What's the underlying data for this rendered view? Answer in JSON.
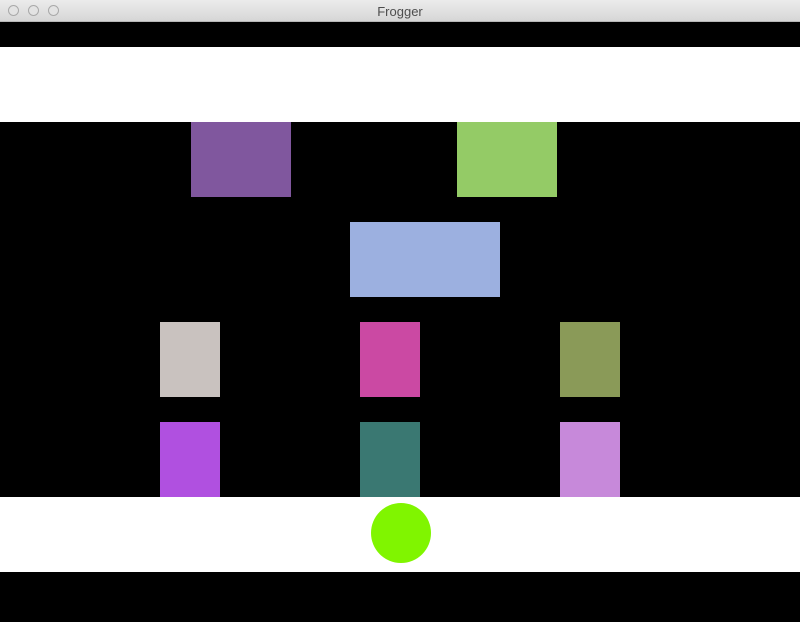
{
  "window": {
    "title": "Frogger"
  },
  "colors": {
    "background": "#000000",
    "safe_zone": "#ffffff",
    "frog": "#80f500"
  },
  "cars": [
    {
      "id": "car-purple",
      "color": "#80579e"
    },
    {
      "id": "car-green",
      "color": "#94cb66"
    },
    {
      "id": "car-blue",
      "color": "#9cb0e0"
    },
    {
      "id": "car-beige",
      "color": "#c9c2bf"
    },
    {
      "id": "car-magenta",
      "color": "#cb49a3"
    },
    {
      "id": "car-olive",
      "color": "#8a9a58"
    },
    {
      "id": "car-violet",
      "color": "#b050e0"
    },
    {
      "id": "car-teal",
      "color": "#3a7872"
    },
    {
      "id": "car-lilac",
      "color": "#c789da"
    }
  ]
}
